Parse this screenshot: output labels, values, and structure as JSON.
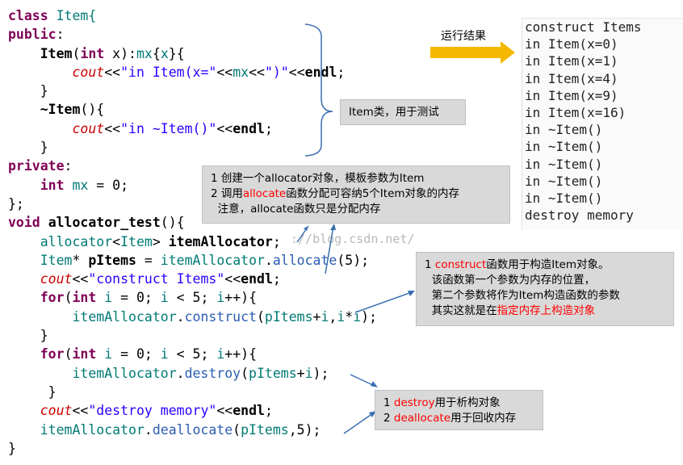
{
  "code": {
    "l1": [
      "class",
      " Item{"
    ],
    "l2": [
      "public",
      ":"
    ],
    "l3": [
      "    ",
      "Item",
      "(",
      "int",
      " x):",
      "mx",
      "{",
      "x",
      "}{"
    ],
    "l4": [
      "        ",
      "cout",
      "<<",
      "\"in Item(x=\"",
      "<<",
      "mx",
      "<<",
      "\")\"",
      "<<",
      "endl",
      ";"
    ],
    "l5": [
      "    }"
    ],
    "l6": [
      "    ",
      "~Item",
      "(){"
    ],
    "l7": [
      "        ",
      "cout",
      "<<",
      "\"in ~Item()\"",
      "<<",
      "endl",
      ";"
    ],
    "l8": [
      "    }"
    ],
    "l9": [
      "private",
      ":"
    ],
    "l10": [
      "    ",
      "int",
      " ",
      "mx",
      " = 0;"
    ],
    "l11": [
      "};"
    ],
    "l12": [
      "void",
      " ",
      "allocator_test",
      "(){"
    ],
    "l13": [
      "    ",
      "allocator",
      "<",
      "Item",
      "> ",
      "itemAllocator",
      ";"
    ],
    "l14": [
      "    ",
      "Item",
      "* ",
      "pItems",
      " = ",
      "itemAllocator",
      ".",
      "allocate",
      "(5);"
    ],
    "l15": [
      "    ",
      "cout",
      "<<",
      "\"construct Items\"",
      "<<",
      "endl",
      ";"
    ],
    "l16": [
      "    ",
      "for",
      "(",
      "int",
      " ",
      "i",
      " = 0; ",
      "i",
      " < 5; ",
      "i",
      "++){"
    ],
    "l17": [
      "        ",
      "itemAllocator",
      ".",
      "construct",
      "(",
      "pItems",
      "+",
      "i",
      ",",
      "i",
      "*",
      "i",
      ");"
    ],
    "l18": [
      "    }"
    ],
    "l19": [
      "    ",
      "for",
      "(",
      "int",
      " ",
      "i",
      " = 0; ",
      "i",
      " < 5; ",
      "i",
      "++){"
    ],
    "l20": [
      "        ",
      "itemAllocator",
      ".",
      "destroy",
      "(",
      "pItems",
      "+",
      "i",
      ");"
    ],
    "l21": [
      "     }"
    ],
    "l22": [
      "    ",
      "cout",
      "<<",
      "\"destroy memory\"",
      "<<",
      "endl",
      ";"
    ],
    "l23": [
      "    ",
      "itemAllocator",
      ".",
      "deallocate",
      "(",
      "pItems",
      ",5);"
    ],
    "l24": [
      "}"
    ]
  },
  "run_label": "运行结果",
  "output_lines": [
    "construct Items",
    "in Item(x=0)",
    "in Item(x=1)",
    "in Item(x=4)",
    "in Item(x=9)",
    "in Item(x=16)",
    "in ~Item()",
    "in ~Item()",
    "in ~Item()",
    "in ~Item()",
    "in ~Item()",
    "destroy memory"
  ],
  "notes": {
    "item_class": "Item类，用于测试",
    "alloc": {
      "line1": "1 创建一个allocator对象，模板参数为Item",
      "line2_prefix": "2 调用",
      "line2_red": "allocate",
      "line2_suffix": "函数分配可容纳5个Item对象的内存",
      "line3": "  注意，allocate函数只是分配内存"
    },
    "construct": {
      "line1_prefix": "1 ",
      "line1_red": "construct",
      "line1_suffix": "函数用于构造Item对象。",
      "line2": "  该函数第一个参数为内存的位置，",
      "line3": "  第二个参数将作为Item构造函数的参数",
      "line4_prefix": "  其实这就是在",
      "line4_red": "指定内存上构造对象"
    },
    "destroy": {
      "line1_prefix": "1 ",
      "line1_red": "destroy",
      "line1_suffix": "用于析构对象",
      "line2_prefix": "2 ",
      "line2_red": "deallocate",
      "line2_suffix": "用于回收内存"
    }
  },
  "watermark": "://blog.csdn.net/",
  "colors": {
    "keyword": "#7f0055",
    "type": "#007a74",
    "method": "#2a5db0",
    "string": "#2a00ff",
    "stream": "#cc0000",
    "arrow_yellow": "#f5b800",
    "arrow_blue": "#3a6fb0",
    "red_text": "#ff0000"
  }
}
